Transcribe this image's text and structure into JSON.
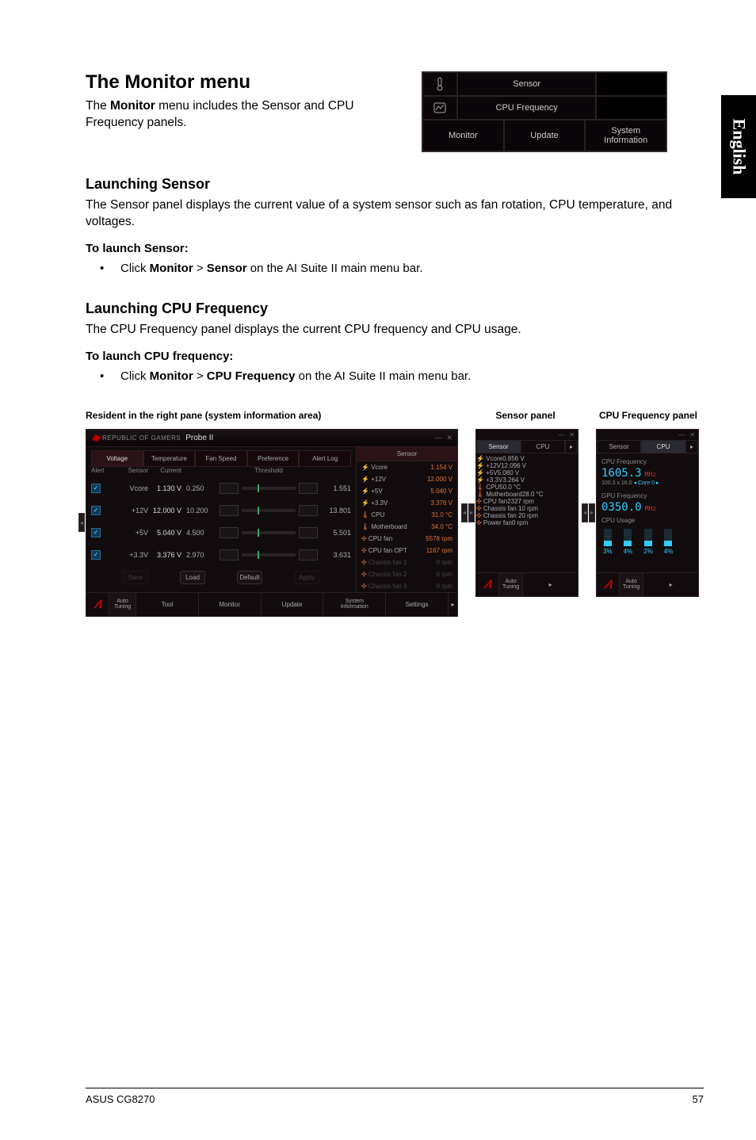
{
  "side_tab": "English",
  "title": "The Monitor menu",
  "intro_pre": "The ",
  "intro_bold": "Monitor",
  "intro_post": " menu includes the Sensor and CPU Frequency panels.",
  "menu_box": {
    "sensor": "Sensor",
    "cpu_freq": "CPU Frequency",
    "monitor": "Monitor",
    "update": "Update",
    "sysinfo_l1": "System",
    "sysinfo_l2": "Information"
  },
  "sensor_heading": "Launching Sensor",
  "sensor_desc": "The Sensor panel displays the current value of a system sensor such as fan rotation, CPU temperature, and voltages.",
  "sensor_launch_label": "To launch Sensor:",
  "sensor_step_pre": "Click ",
  "sensor_step_b1": "Monitor",
  "sensor_step_mid": " > ",
  "sensor_step_b2": "Sensor",
  "sensor_step_post": " on the AI Suite II main menu bar.",
  "cpu_heading": "Launching CPU Frequency",
  "cpu_desc": "The CPU Frequency panel displays the current CPU frequency and CPU usage.",
  "cpu_launch_label": "To launch CPU frequency:",
  "cpu_step_pre": "Click ",
  "cpu_step_b1": "Monitor",
  "cpu_step_mid": " > ",
  "cpu_step_b2": "CPU Frequency",
  "cpu_step_post": " on the AI Suite II main menu bar.",
  "captions": {
    "resident": "Resident in the right pane (system information area)",
    "sensor": "Sensor panel",
    "cpu": "CPU Frequency panel"
  },
  "probe": {
    "brand": "REPUBLIC OF GAMERS",
    "name": "Probe II",
    "tabs": [
      "Voltage",
      "Temperature",
      "Fan Speed",
      "Preference",
      "Alert Log"
    ],
    "headers": {
      "alert": "Alert",
      "sensor": "Sensor",
      "current": "Current",
      "threshold": "Threshold"
    },
    "rows": [
      {
        "name": "Vcore",
        "current": "1.130 V",
        "low": "0.250",
        "high": "1.551"
      },
      {
        "name": "+12V",
        "current": "12.000 V",
        "low": "10.200",
        "high": "13.801"
      },
      {
        "name": "+5V",
        "current": "5.040 V",
        "low": "4.500",
        "high": "5.501"
      },
      {
        "name": "+3.3V",
        "current": "3.376 V",
        "low": "2.970",
        "high": "3.631"
      }
    ],
    "buttons": {
      "save": "Save",
      "load": "Load",
      "default": "Default",
      "apply": "Apply"
    },
    "right_tab": "Sensor",
    "right_rows": [
      {
        "name": "Vcore",
        "value": "1.154 V",
        "dim": false,
        "icon": "bolt"
      },
      {
        "name": "+12V",
        "value": "12.000 V",
        "dim": false,
        "icon": "bolt"
      },
      {
        "name": "+5V",
        "value": "5.040 V",
        "dim": false,
        "icon": "bolt"
      },
      {
        "name": "+3.3V",
        "value": "3.376 V",
        "dim": false,
        "icon": "bolt"
      },
      {
        "name": "CPU",
        "value": "31.0 °C",
        "dim": false,
        "icon": "temp"
      },
      {
        "name": "Motherboard",
        "value": "34.0 °C",
        "dim": false,
        "icon": "temp"
      },
      {
        "name": "CPU fan",
        "value": "5578 rpm",
        "dim": false,
        "icon": "fan"
      },
      {
        "name": "CPU fan OPT",
        "value": "1167 rpm",
        "dim": false,
        "icon": "fan"
      },
      {
        "name": "Chassis fan 1",
        "value": "0 rpm",
        "dim": true,
        "icon": "fan"
      },
      {
        "name": "Chassis fan 2",
        "value": "0 rpm",
        "dim": true,
        "icon": "fan"
      },
      {
        "name": "Chassis fan 3",
        "value": "0 rpm",
        "dim": true,
        "icon": "fan"
      }
    ]
  },
  "bottom_bar": {
    "auto_l1": "Auto",
    "auto_l2": "Tuning",
    "tool": "Tool",
    "monitor": "Monitor",
    "update": "Update",
    "sysinfo_l1": "System",
    "sysinfo_l2": "Information",
    "settings": "Settings"
  },
  "mini_sensor": {
    "tabs": {
      "sensor": "Sensor",
      "cpu": "CPU"
    },
    "rows": [
      {
        "name": "Vcore",
        "value": "0.856 V",
        "dim": false,
        "icon": "bolt"
      },
      {
        "name": "+12V",
        "value": "12.096 V",
        "dim": false,
        "icon": "bolt"
      },
      {
        "name": "+5V",
        "value": "5.080 V",
        "dim": false,
        "icon": "bolt"
      },
      {
        "name": "+3.3V",
        "value": "3.264 V",
        "dim": false,
        "icon": "bolt"
      },
      {
        "name": "CPU",
        "value": "50.0 °C",
        "dim": false,
        "icon": "temp"
      },
      {
        "name": "Motherboard",
        "value": "28.0 °C",
        "dim": false,
        "icon": "temp"
      },
      {
        "name": "CPU fan",
        "value": "2327 rpm",
        "dim": false,
        "icon": "fan"
      },
      {
        "name": "Chassis fan 1",
        "value": "0 rpm",
        "dim": true,
        "icon": "fan"
      },
      {
        "name": "Chassis fan 2",
        "value": "0 rpm",
        "dim": true,
        "icon": "fan"
      },
      {
        "name": "Power fan",
        "value": "0 rpm",
        "dim": true,
        "icon": "fan"
      }
    ]
  },
  "mini_cpu": {
    "tabs": {
      "sensor": "Sensor",
      "cpu": "CPU"
    },
    "cpu_label": "CPU Frequency",
    "cpu_value": "1605.3",
    "unit": "MHz",
    "cpu_sub_a": "100.3 x 16.0",
    "cpu_sub_b": "Core 0",
    "gpu_label": "GPU Frequency",
    "gpu_value": "0350.0",
    "usage_label": "CPU Usage",
    "usage": [
      "3%",
      "4%",
      "2%",
      "4%"
    ]
  },
  "footer": {
    "model": "ASUS CG8270",
    "page": "57"
  }
}
